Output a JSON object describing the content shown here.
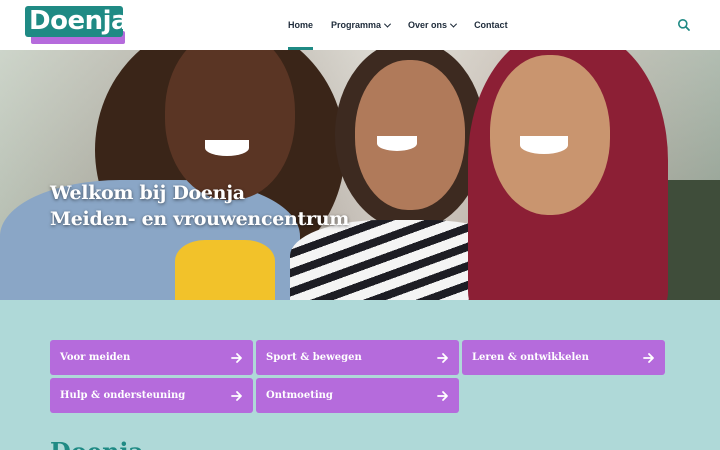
{
  "header": {
    "logo_text": "Doenja",
    "nav": [
      {
        "label": "Home",
        "active": true
      },
      {
        "label": "Programma",
        "has_dropdown": true
      },
      {
        "label": "Over ons",
        "has_dropdown": true
      },
      {
        "label": "Contact"
      }
    ],
    "search_icon": "search-icon"
  },
  "hero": {
    "title_line1": "Welkom bij Doenja",
    "title_line2": "Meiden- en vrouwencentrum"
  },
  "tiles": [
    {
      "label": "Voor meiden"
    },
    {
      "label": "Sport & bewegen"
    },
    {
      "label": "Leren & ontwikkelen"
    },
    {
      "label": "Hulp & ondersteuning"
    },
    {
      "label": "Ontmoeting"
    }
  ],
  "section": {
    "heading": "Doenja"
  },
  "colors": {
    "brand_teal": "#1f8a84",
    "tile_purple": "#b56bdc",
    "section_bg": "#afd9d8"
  }
}
